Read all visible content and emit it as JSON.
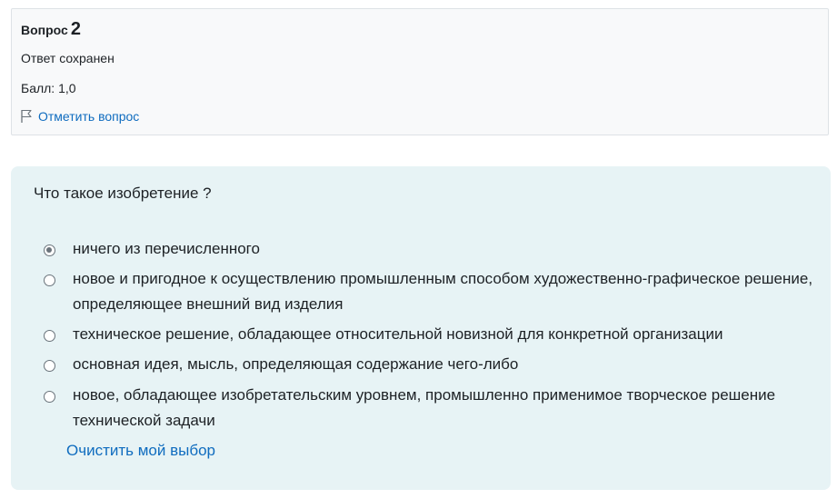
{
  "info": {
    "question_label": "Вопрос",
    "question_number": "2",
    "state": "Ответ сохранен",
    "grade": "Балл: 1,0",
    "flag_label": "Отметить вопрос"
  },
  "question": {
    "text": "Что такое изобретение ?",
    "answers": [
      {
        "label": "ничего из перечисленного",
        "selected": true
      },
      {
        "label": "новое и пригодное к осуществлению промышленным способом художественно-графическое решение, определяющее внешний вид изделия",
        "selected": false
      },
      {
        "label": "техническое решение, обладающее относительной новизной для конкретной организации",
        "selected": false
      },
      {
        "label": "основная идея, мысль, определяющая содержание чего-либо",
        "selected": false
      },
      {
        "label": "новое, обладающее изобретательским уровнем, промышленно применимое творческое решение технической задачи",
        "selected": false
      }
    ],
    "clear_label": "Очистить мой выбор"
  },
  "icons": {
    "flag": "flag-outline-icon",
    "radio": "radio-button-icon"
  },
  "colors": {
    "link": "#0f6cbf",
    "content_bg": "#e7f3f5",
    "info_bg": "#f8f9fa"
  }
}
